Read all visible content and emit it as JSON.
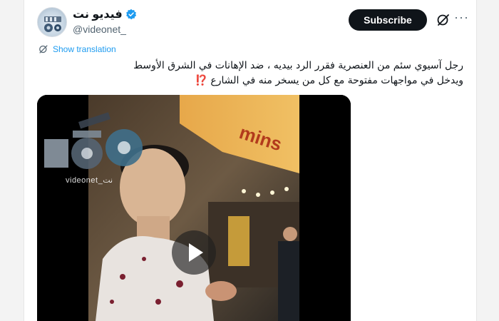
{
  "account": {
    "display_name": "فيديو نت",
    "handle": "@videonet_",
    "verified": true
  },
  "actions": {
    "subscribe_label": "Subscribe",
    "grok_icon": "grok-icon",
    "more_icon": "more-icon"
  },
  "translation": {
    "label": "Show translation"
  },
  "tweet": {
    "line1": "رجل آسيوي سئم من العنصرية فقرر الرد بيديه ، ضد الإهانات في الشرق الأوسط",
    "line2": "ويدخل في مواجهات مفتوحة مع كل من يسخر منه في الشارع",
    "emphasis": "⁉️"
  },
  "media": {
    "watermark": "videonet_نت",
    "play_icon": "play-icon",
    "sign_text": "mins"
  },
  "colors": {
    "accent": "#1d9bf0",
    "subscribe_bg": "#0f1419",
    "verified": "#1d9bf0",
    "emphasis": "#e0245e"
  }
}
